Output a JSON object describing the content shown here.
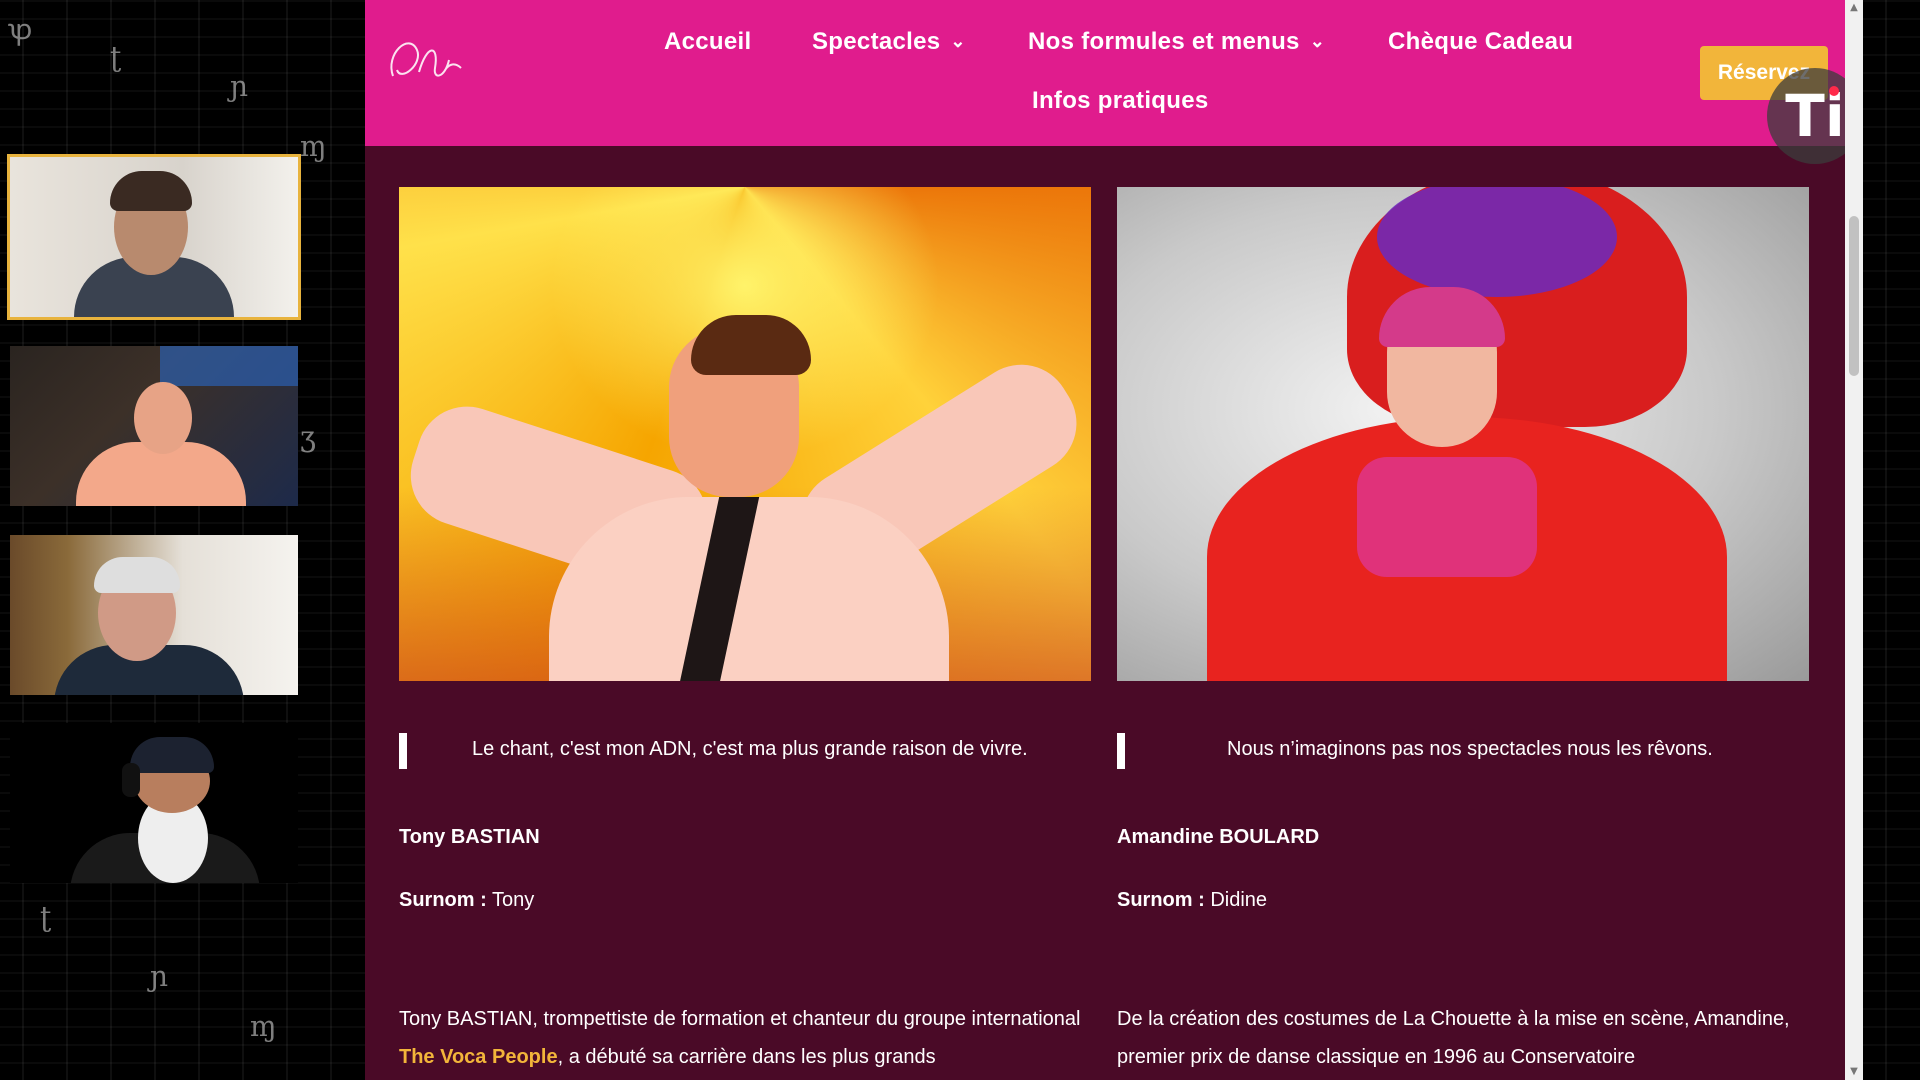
{
  "nav": {
    "items": [
      "Accueil",
      "Spectacles",
      "Nos formules et menus",
      "Chèque Cadeau",
      "Infos pratiques"
    ],
    "reserve_label": "Réservez",
    "logo_text": "La Chouette"
  },
  "badge": {
    "text": "Ti"
  },
  "artists": [
    {
      "quote": "Le chant, c'est mon ADN, c'est ma plus grande raison de vivre.",
      "name": "Tony BASTIAN",
      "nick_label": "Surnom :",
      "nick": "Tony",
      "bio_before": "Tony BASTIAN, trompettiste de formation et chanteur du groupe international ",
      "bio_highlight": "The Voca People",
      "bio_after": ", a débuté sa carrière dans les plus grands"
    },
    {
      "quote": "Nous n’imaginons pas nos spectacles nous les rêvons.",
      "name": "Amandine BOULARD",
      "nick_label": "Surnom :",
      "nick": "Didine",
      "bio": "De la création des costumes de La Chouette à la mise en scène, Amandine, premier prix de danse classique en 1996 au Conservatoire"
    }
  ],
  "colors": {
    "navbar": "#e01c8d",
    "page_bg": "#4a0a27",
    "accent": "#f2b53a",
    "active_tile": "#e8b33d"
  },
  "icons": [
    "chevron-down-icon",
    "ti-logo-icon"
  ]
}
